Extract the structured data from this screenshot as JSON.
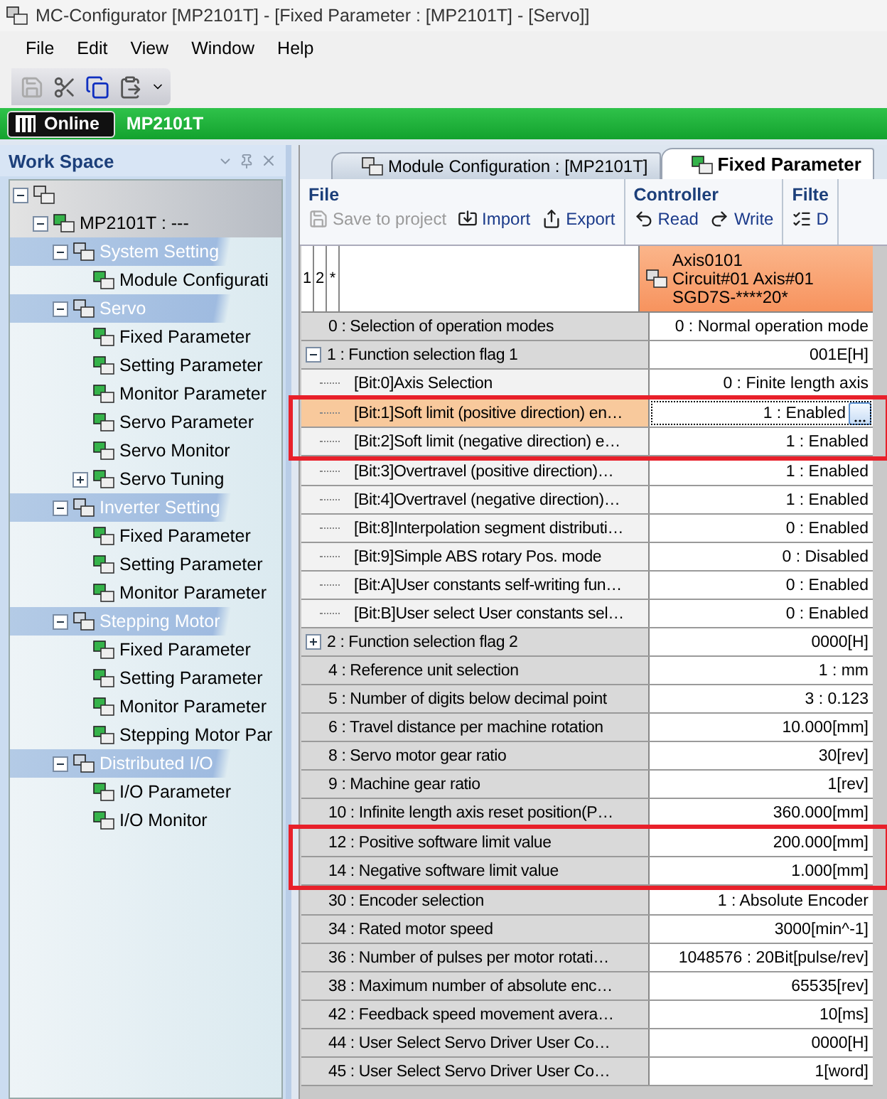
{
  "window": {
    "title": "MC-Configurator [MP2101T] - [Fixed Parameter : [MP2101T] - [Servo]]"
  },
  "menu": [
    "File",
    "Edit",
    "View",
    "Window",
    "Help"
  ],
  "status": {
    "mode": "Online",
    "device": "MP2101T"
  },
  "workspace": {
    "title": "Work Space",
    "tree": [
      {
        "expanded": true,
        "children": [
          {
            "label": "MP2101T : ---",
            "expanded": true,
            "children": [
              {
                "label": "System Setting",
                "kind": "category",
                "expanded": true,
                "children": [
                  {
                    "label": "Module Configurati"
                  }
                ]
              },
              {
                "label": "Servo",
                "kind": "category",
                "expanded": true,
                "children": [
                  {
                    "label": "Fixed Parameter"
                  },
                  {
                    "label": "Setting Parameter"
                  },
                  {
                    "label": "Monitor Parameter"
                  },
                  {
                    "label": "Servo Parameter"
                  },
                  {
                    "label": "Servo Monitor"
                  },
                  {
                    "label": "Servo Tuning",
                    "expanded": false
                  }
                ]
              },
              {
                "label": "Inverter Setting",
                "kind": "category",
                "expanded": true,
                "children": [
                  {
                    "label": "Fixed Parameter"
                  },
                  {
                    "label": "Setting Parameter"
                  },
                  {
                    "label": "Monitor Parameter"
                  }
                ]
              },
              {
                "label": "Stepping Motor",
                "kind": "category",
                "expanded": true,
                "children": [
                  {
                    "label": "Fixed Parameter"
                  },
                  {
                    "label": "Setting Parameter"
                  },
                  {
                    "label": "Monitor Parameter"
                  },
                  {
                    "label": "Stepping Motor Par"
                  }
                ]
              },
              {
                "label": "Distributed I/O",
                "kind": "category",
                "expanded": true,
                "children": [
                  {
                    "label": "I/O Parameter"
                  },
                  {
                    "label": "I/O Monitor"
                  }
                ]
              }
            ]
          }
        ]
      }
    ]
  },
  "tabs": [
    {
      "label": "Module Configuration : [MP2101T]",
      "selected": false
    },
    {
      "label": "Fixed Parameter",
      "selected": true
    }
  ],
  "ribbon": [
    {
      "title": "File",
      "buttons": [
        {
          "label": "Save to project",
          "disabled": true
        },
        {
          "label": "Import",
          "disabled": false
        },
        {
          "label": "Export",
          "disabled": false
        }
      ]
    },
    {
      "title": "Controller",
      "buttons": [
        {
          "label": "Read",
          "disabled": false
        },
        {
          "label": "Write",
          "disabled": false
        }
      ]
    },
    {
      "title": "Filte",
      "buttons": [
        {
          "label": "D",
          "disabled": false
        }
      ]
    }
  ],
  "grid": {
    "header": [
      "1",
      "2",
      "*"
    ],
    "axis": [
      "Axis0101",
      "Circuit#01 Axis#01",
      "SGD7S-****20*"
    ],
    "rows": [
      {
        "kind": "param",
        "label": "0 : Selection of operation modes",
        "value": "0 : Normal operation mode",
        "selected": false
      },
      {
        "kind": "group",
        "label": "1 : Function selection flag 1",
        "value": "001E[H]",
        "expanded": true,
        "selected": false
      },
      {
        "kind": "bit",
        "label": "[Bit:0]Axis Selection",
        "value": "0 : Finite length axis",
        "selected": false
      },
      {
        "kind": "bit",
        "label": "[Bit:1]Soft limit (positive direction) en…",
        "value": "1 : Enabled",
        "selected": true,
        "highlight": true
      },
      {
        "kind": "bit",
        "label": "[Bit:2]Soft limit (negative direction) e…",
        "value": "1 : Enabled",
        "selected": false,
        "highlight": true
      },
      {
        "kind": "bit",
        "label": "[Bit:3]Overtravel (positive direction)…",
        "value": "1 : Enabled",
        "selected": false
      },
      {
        "kind": "bit",
        "label": "[Bit:4]Overtravel (negative direction)…",
        "value": "1 : Enabled",
        "selected": false
      },
      {
        "kind": "bit",
        "label": "[Bit:8]Interpolation segment distributi…",
        "value": "0 : Enabled",
        "selected": false
      },
      {
        "kind": "bit",
        "label": "[Bit:9]Simple ABS rotary Pos. mode",
        "value": "0 : Disabled",
        "selected": false
      },
      {
        "kind": "bit",
        "label": "[Bit:A]User constants self-writing fun…",
        "value": "0 : Enabled",
        "selected": false
      },
      {
        "kind": "bit",
        "label": "[Bit:B]User select User constants sel…",
        "value": "0 : Enabled",
        "selected": false
      },
      {
        "kind": "group",
        "label": "2 : Function selection flag 2",
        "value": "0000[H]",
        "expanded": false,
        "selected": false
      },
      {
        "kind": "param",
        "label": "4 : Reference unit selection",
        "value": "1 : mm",
        "selected": false
      },
      {
        "kind": "param",
        "label": "5 : Number of digits below decimal point",
        "value": "3 : 0.123",
        "selected": false
      },
      {
        "kind": "param",
        "label": "6 : Travel distance per machine rotation",
        "value": "10.000[mm]",
        "selected": false
      },
      {
        "kind": "param",
        "label": "8 : Servo motor gear ratio",
        "value": "30[rev]",
        "selected": false
      },
      {
        "kind": "param",
        "label": "9 : Machine gear ratio",
        "value": "1[rev]",
        "selected": false
      },
      {
        "kind": "param",
        "label": "10 : Infinite length axis reset position(P…",
        "value": "360.000[mm]",
        "selected": false
      },
      {
        "kind": "param",
        "label": "12 : Positive software limit value",
        "value": "200.000[mm]",
        "selected": false,
        "highlight": true
      },
      {
        "kind": "param",
        "label": "14 : Negative software limit value",
        "value": "1.000[mm]",
        "selected": false,
        "highlight": true
      },
      {
        "kind": "param",
        "label": "30 : Encoder selection",
        "value": "1 : Absolute Encoder",
        "selected": false
      },
      {
        "kind": "param",
        "label": "34 : Rated motor speed",
        "value": "3000[min^-1]",
        "selected": false
      },
      {
        "kind": "param",
        "label": "36 : Number of pulses per motor rotati…",
        "value": "1048576 : 20Bit[pulse/rev]",
        "selected": false
      },
      {
        "kind": "param",
        "label": "38 : Maximum number of absolute enc…",
        "value": "65535[rev]",
        "selected": false
      },
      {
        "kind": "param",
        "label": "42 : Feedback speed movement avera…",
        "value": "10[ms]",
        "selected": false
      },
      {
        "kind": "param",
        "label": "44 : User Select Servo Driver User Co…",
        "value": "0000[H]",
        "selected": false
      },
      {
        "kind": "param",
        "label": "45 : User Select Servo Driver User Co…",
        "value": "1[word]",
        "selected": false
      }
    ]
  }
}
